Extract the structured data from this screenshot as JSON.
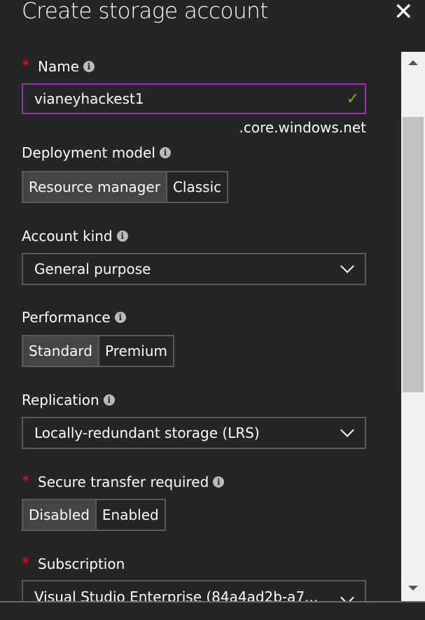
{
  "title": "Create storage account",
  "close_icon": "close-icon",
  "name": {
    "label": "Name",
    "required": true,
    "value": "vianeyhackest1",
    "suffix": ".core.windows.net",
    "valid": true,
    "border_color": "#9b2fae",
    "check_color": "#7fba00"
  },
  "deployment": {
    "label": "Deployment model",
    "options": [
      "Resource manager",
      "Classic"
    ],
    "selected": "Resource manager"
  },
  "account_kind": {
    "label": "Account kind",
    "value": "General purpose"
  },
  "performance": {
    "label": "Performance",
    "options": [
      "Standard",
      "Premium"
    ],
    "selected": "Standard"
  },
  "replication": {
    "label": "Replication",
    "value": "Locally-redundant storage (LRS)"
  },
  "secure_transfer": {
    "label": "Secure transfer required",
    "required": true,
    "options": [
      "Disabled",
      "Enabled"
    ],
    "selected": "Disabled"
  },
  "subscription": {
    "label": "Subscription",
    "required": true,
    "value": "Visual Studio Enterprise (84a4ad2b-a7..."
  },
  "required_mark": "*",
  "info_glyph": "i",
  "check_glyph": "✓",
  "close_glyph": "✕",
  "colors": {
    "background": "#252525",
    "required": "#e81123",
    "selected_segment": "#444444"
  }
}
